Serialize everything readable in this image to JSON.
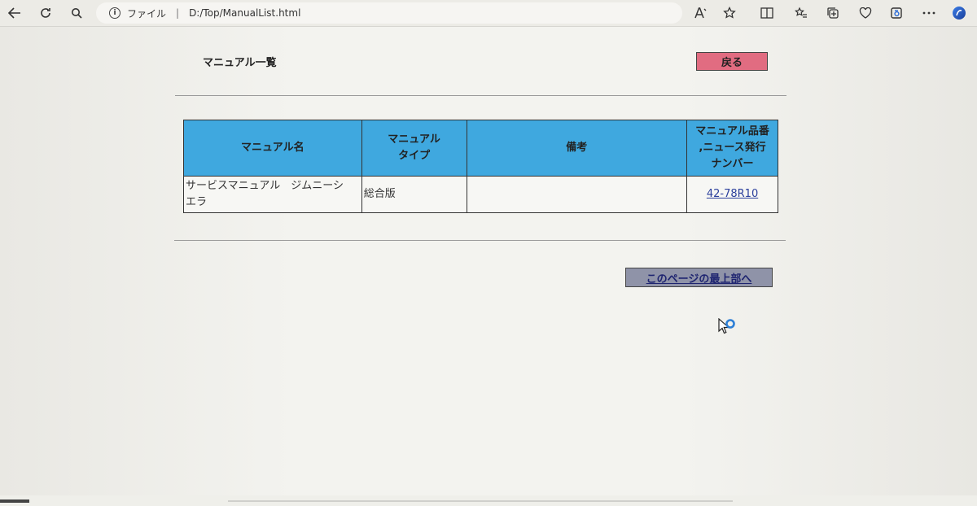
{
  "browser": {
    "address_label": "ファイル",
    "url": "D:/Top/ManualList.html",
    "nav_icons": [
      "back-icon",
      "refresh-icon",
      "search-icon"
    ],
    "toolbar_icons": [
      "read-aloud-icon",
      "favorite-star-icon",
      "split-screen-icon",
      "favorites-list-icon",
      "collections-icon",
      "heart-icon",
      "extension-icon",
      "more-icon",
      "copilot-icon"
    ]
  },
  "page": {
    "title": "マニュアル一覧",
    "back_label": "戻る",
    "top_link_label": "このページの最上部へ"
  },
  "table": {
    "headers": [
      [
        "マニュアル名"
      ],
      [
        "マニュアル",
        "タイプ"
      ],
      [
        "備考"
      ],
      [
        "マニュアル品番",
        ",ニュース発行",
        "ナンバー"
      ]
    ],
    "rows": [
      {
        "name_lines": [
          "サービスマニュアル　ジムニーシ",
          "エラ"
        ],
        "type": "総合版",
        "remarks": "",
        "number": "42-78R10"
      }
    ]
  },
  "colors": {
    "header_bg": "#3fa8df",
    "back_button_bg": "#e16c81",
    "top_button_bg": "#8f93a8",
    "link": "#2b3f9c"
  }
}
